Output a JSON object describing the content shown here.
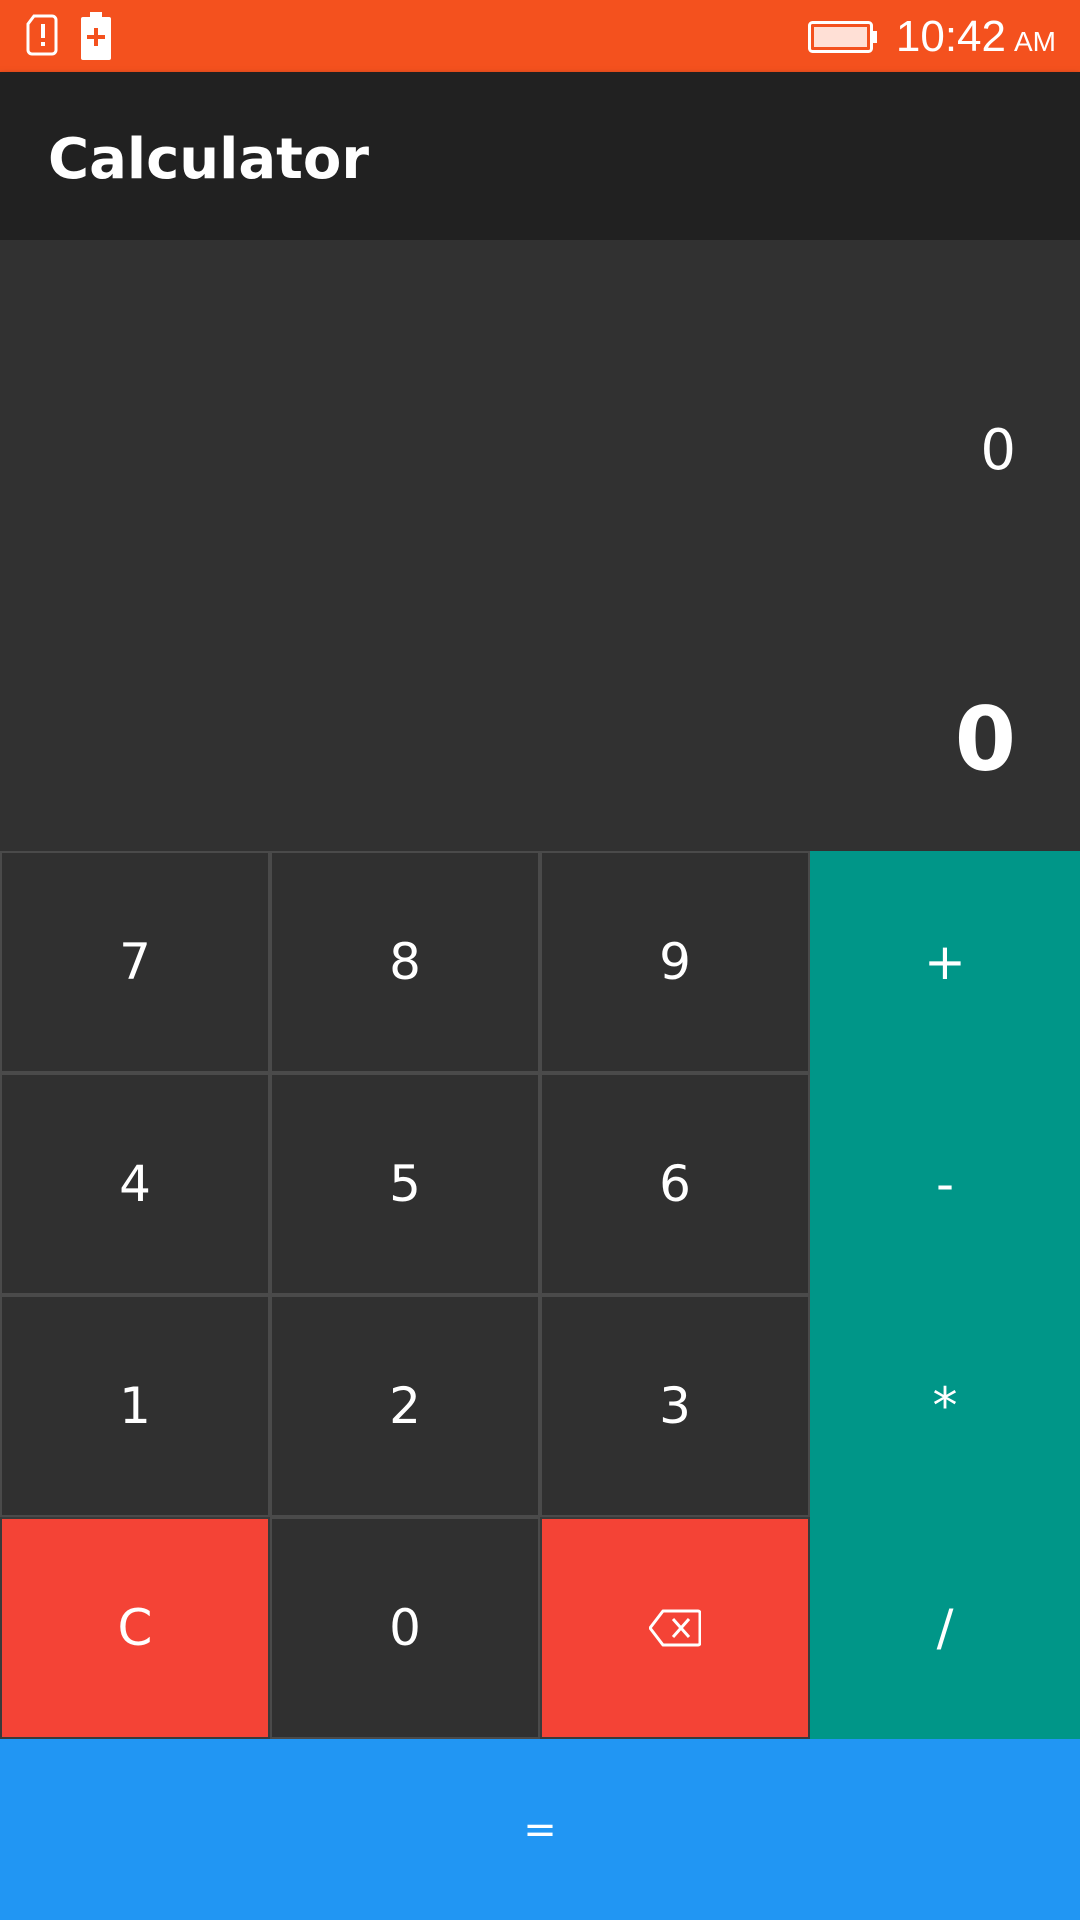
{
  "status_bar": {
    "time": "10:42",
    "ampm": "AM",
    "color": "#F4511E",
    "icons": [
      "sim-alert-icon",
      "battery-alert-icon",
      "battery-icon"
    ]
  },
  "app_bar": {
    "title": "Calculator"
  },
  "display": {
    "expression": "0",
    "result": "0"
  },
  "keys": {
    "seven": "7",
    "eight": "8",
    "nine": "9",
    "plus": "+",
    "four": "4",
    "five": "5",
    "six": "6",
    "minus": "-",
    "one": "1",
    "two": "2",
    "three": "3",
    "multiply": "*",
    "clear": "C",
    "zero": "0",
    "backspace": "backspace-icon",
    "divide": "/",
    "equals": "="
  },
  "colors": {
    "operator": "#009688",
    "danger": "#F44336",
    "equals": "#2196F3",
    "app_bar": "#212121",
    "background": "#303030"
  }
}
